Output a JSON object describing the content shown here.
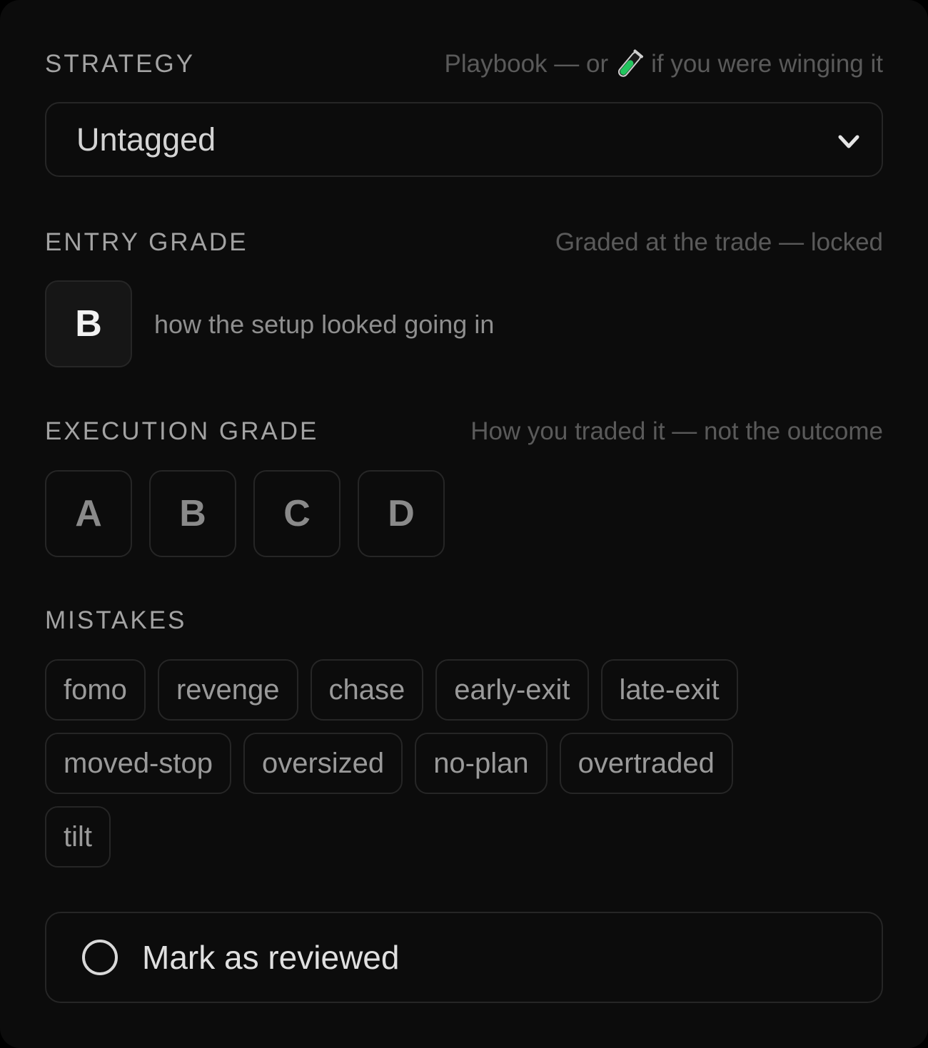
{
  "strategy": {
    "label": "STRATEGY",
    "hint_before": "Playbook — or",
    "hint_icon": "test-tube-icon",
    "hint_after": "if you were winging it",
    "selected": "Untagged"
  },
  "entry_grade": {
    "label": "ENTRY GRADE",
    "hint": "Graded at the trade — locked",
    "value": "B",
    "note": "how the setup looked going in"
  },
  "execution_grade": {
    "label": "EXECUTION GRADE",
    "hint": "How you traded it — not the outcome",
    "options": [
      "A",
      "B",
      "C",
      "D"
    ]
  },
  "mistakes": {
    "label": "MISTAKES",
    "tags": [
      "fomo",
      "revenge",
      "chase",
      "early-exit",
      "late-exit",
      "moved-stop",
      "oversized",
      "no-plan",
      "overtraded",
      "tilt"
    ]
  },
  "review": {
    "label": "Mark as reviewed"
  },
  "colors": {
    "background": "#0c0c0c",
    "border": "#262626",
    "tube_liquid": "#22c55e"
  }
}
